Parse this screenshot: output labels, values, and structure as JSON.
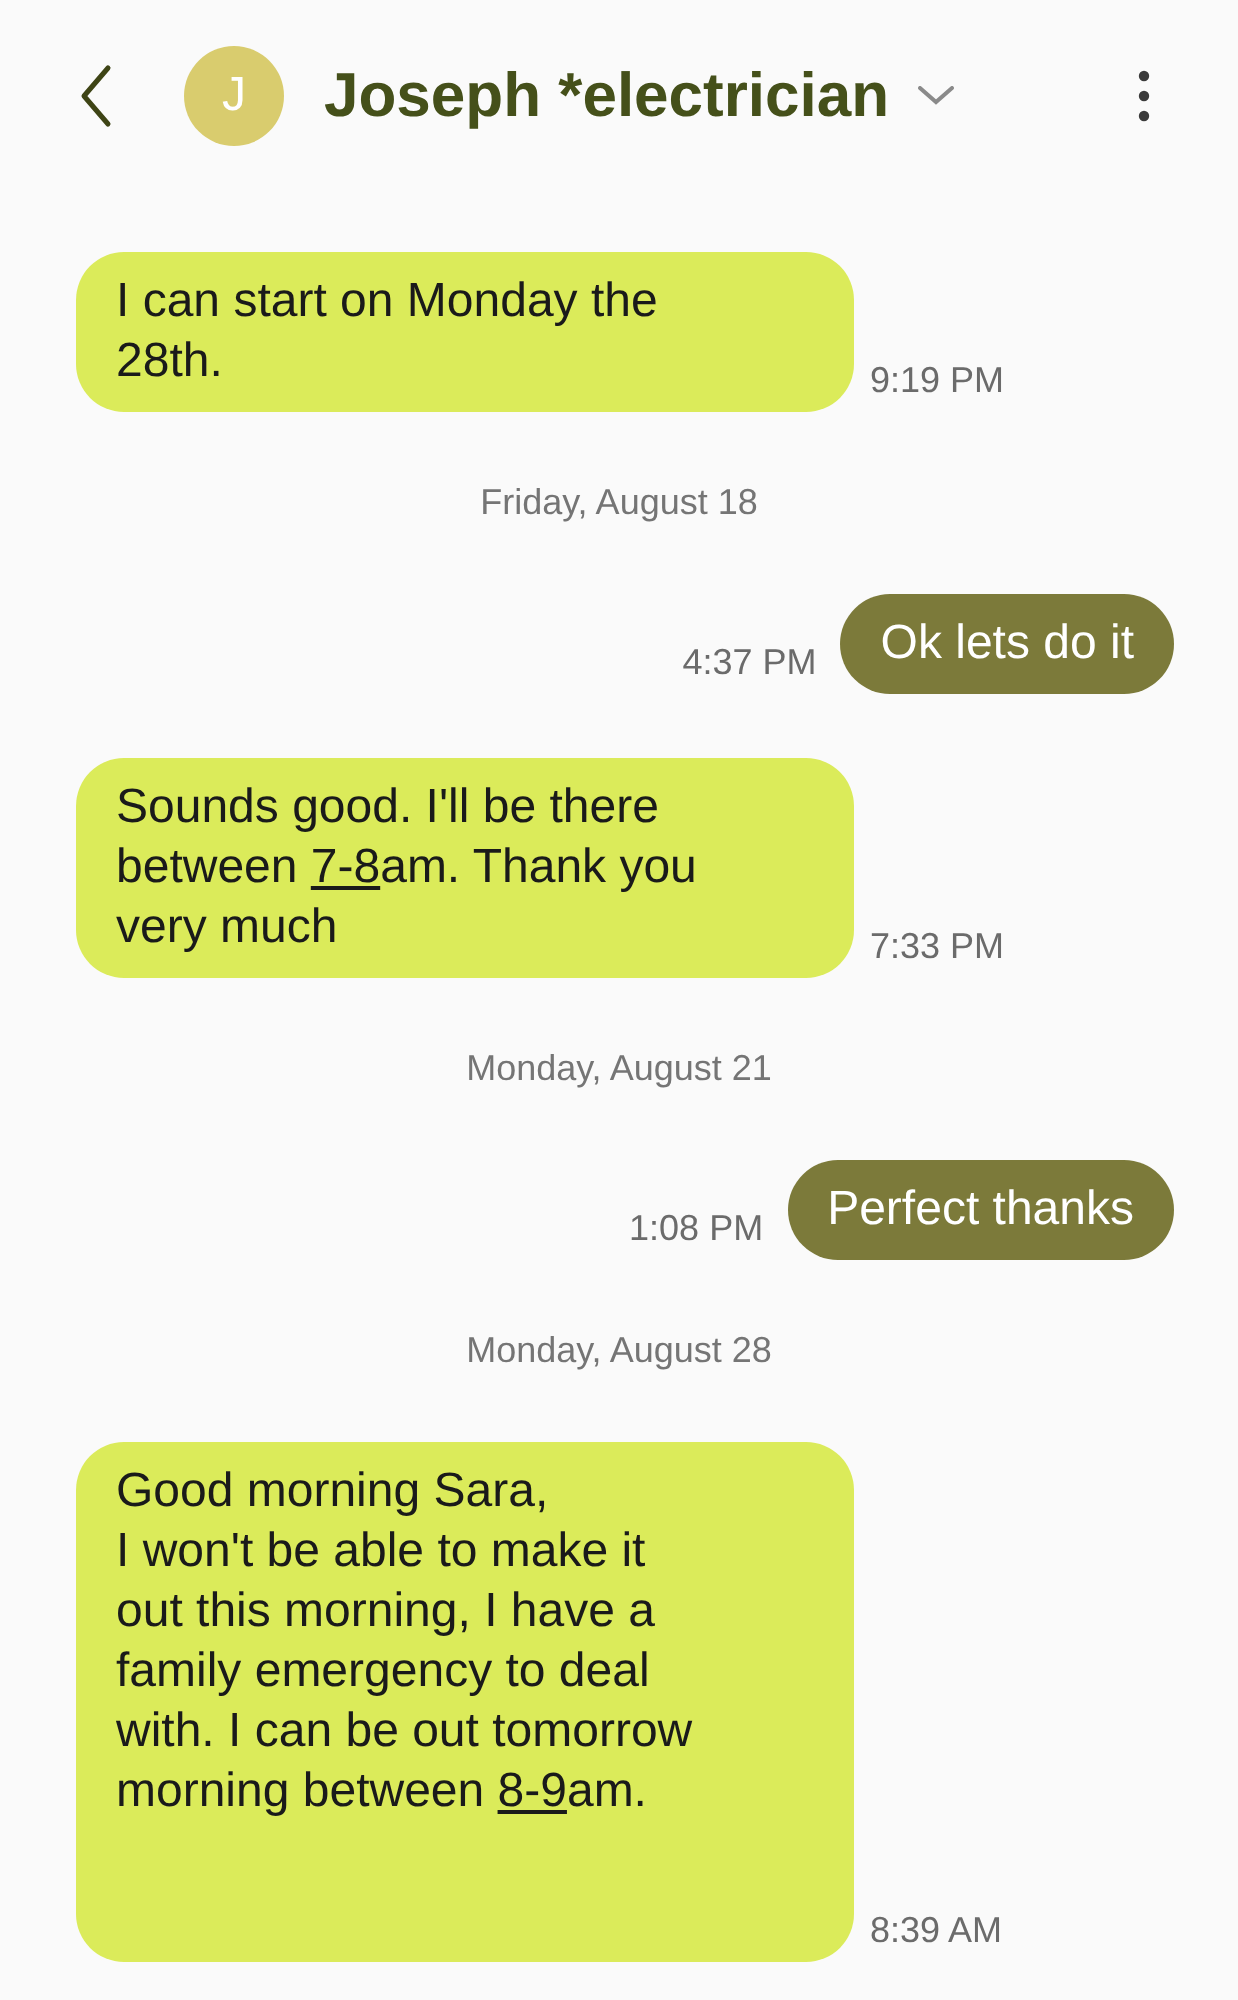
{
  "header": {
    "avatar_letter": "J",
    "title": "Joseph *electrician"
  },
  "items": [
    {
      "kind": "received",
      "parts": [
        {
          "text": "I can start on Monday the 28th.",
          "link": false
        }
      ],
      "time": "9:19 PM"
    },
    {
      "kind": "date",
      "text": "Friday, August 18"
    },
    {
      "kind": "sent",
      "parts": [
        {
          "text": "Ok lets do it",
          "link": false
        }
      ],
      "time": "4:37 PM"
    },
    {
      "kind": "received",
      "parts": [
        {
          "text": "Sounds good. I'll be there between ",
          "link": false
        },
        {
          "text": "7-8",
          "link": true
        },
        {
          "text": "am. Thank you very much",
          "link": false
        }
      ],
      "time": "7:33 PM"
    },
    {
      "kind": "date",
      "text": "Monday, August 21"
    },
    {
      "kind": "sent",
      "parts": [
        {
          "text": "Perfect thanks",
          "link": false
        }
      ],
      "time": "1:08 PM"
    },
    {
      "kind": "date",
      "text": "Monday, August 28"
    },
    {
      "kind": "received",
      "parts": [
        {
          "text": "Good morning Sara,\nI won't be able to make it out this morning, I have a family emergency to deal with. I can be out tomorrow morning between ",
          "link": false
        },
        {
          "text": "8-9",
          "link": true
        },
        {
          "text": "am.\n\n\n",
          "link": false
        }
      ],
      "time": "8:39 AM"
    }
  ]
}
